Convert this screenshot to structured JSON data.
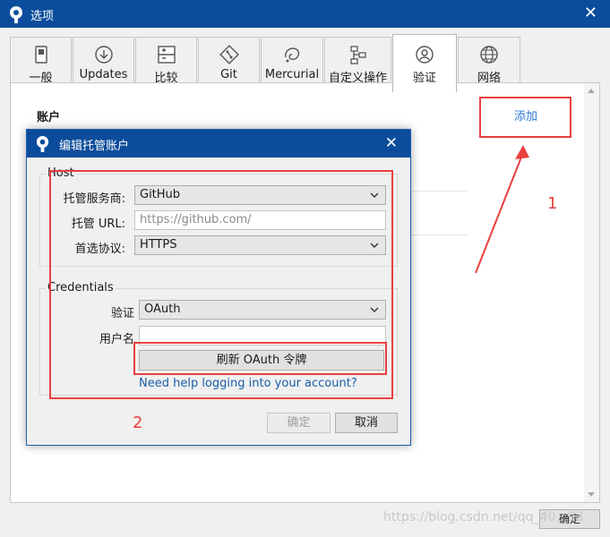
{
  "window": {
    "title": "选项",
    "close_glyph": "✕"
  },
  "tabs": [
    {
      "label": "一般",
      "icon": "switch-icon"
    },
    {
      "label": "Updates",
      "icon": "download-icon"
    },
    {
      "label": "比较",
      "icon": "compare-icon"
    },
    {
      "label": "Git",
      "icon": "git-icon"
    },
    {
      "label": "Mercurial",
      "icon": "mercurial-icon"
    },
    {
      "label": "自定义操作",
      "icon": "custom-actions-icon"
    },
    {
      "label": "验证",
      "icon": "user-icon",
      "active": true
    },
    {
      "label": "网络",
      "icon": "globe-icon"
    }
  ],
  "accounts": {
    "heading": "账户",
    "add_label": "添加"
  },
  "annotations": {
    "one": "1",
    "two": "2",
    "color": "#e8403f"
  },
  "main_ok": "确定",
  "watermark": "https://blog.csdn.net/qq_40...93",
  "dialog": {
    "title": "编辑托管账户",
    "close_glyph": "✕",
    "host": {
      "group_label": "Host",
      "provider_label": "托管服务商:",
      "provider_value": "GitHub",
      "url_label": "托管 URL:",
      "url_placeholder": "https://github.com/",
      "protocol_label": "首选协议:",
      "protocol_value": "HTTPS"
    },
    "credentials": {
      "group_label": "Credentials",
      "auth_label": "验证",
      "auth_value": "OAuth",
      "username_label": "用户名",
      "username_value": "",
      "refresh_button": "刷新 OAuth 令牌",
      "help_link": "Need help logging into your account?"
    },
    "ok_button": "确定",
    "cancel_button": "取消"
  },
  "colors": {
    "titlebar": "#0b4d9c",
    "link": "#2a7ad2",
    "annotation": "#e8403f"
  }
}
